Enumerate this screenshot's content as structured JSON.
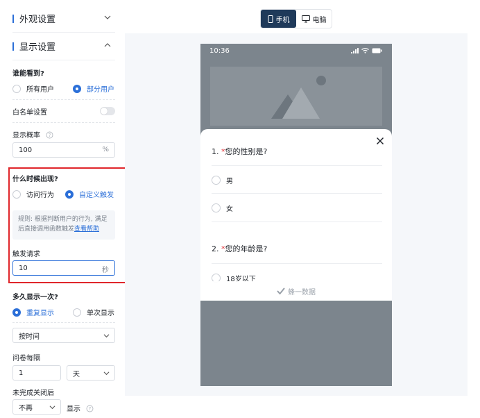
{
  "sections": {
    "appearance": {
      "title": "外观设置",
      "expanded": false
    },
    "display": {
      "title": "显示设置",
      "expanded": true
    }
  },
  "who_can_see": {
    "label": "谁能看到?",
    "options": [
      {
        "label": "所有用户",
        "selected": false
      },
      {
        "label": "部分用户",
        "selected": true
      }
    ]
  },
  "whitelist": {
    "label": "白名单设置",
    "enabled": false
  },
  "display_probability": {
    "label": "显示概率",
    "value": "100",
    "unit": "%"
  },
  "when_to_show": {
    "label": "什么时候出现?",
    "options": [
      {
        "label": "访问行为",
        "selected": false
      },
      {
        "label": "自定义触发",
        "selected": true
      }
    ],
    "rule_text": "规则: 根据判断用户的行为, 满足后直接调用函数触发",
    "rule_link": "查看帮助"
  },
  "trigger_request": {
    "label": "触发请求",
    "value": "10",
    "unit": "秒"
  },
  "how_often": {
    "label": "多久显示一次?",
    "options": [
      {
        "label": "重复显示",
        "selected": true
      },
      {
        "label": "单次显示",
        "selected": false
      }
    ],
    "mode_select": "按时间"
  },
  "interval": {
    "label": "问卷每隔",
    "value": "1",
    "unit_select": "天"
  },
  "after_close": {
    "label": "未完成关闭后",
    "select_value": "不再",
    "suffix": "显示"
  },
  "device_toggle": {
    "mobile": "手机",
    "desktop": "电脑",
    "active": "mobile"
  },
  "phone": {
    "time": "10:36",
    "questions": [
      {
        "number": "1.",
        "required_mark": "*",
        "text": "您的性别是?",
        "options": [
          "男",
          "女"
        ]
      },
      {
        "number": "2.",
        "required_mark": "*",
        "text": "您的年龄是?",
        "options": [
          "18岁以下"
        ]
      }
    ],
    "footer": "蜂一数据"
  },
  "colors": {
    "accent": "#2b6fd8",
    "highlight_border": "#e0262b",
    "toggle_active": "#1f3a5a"
  }
}
